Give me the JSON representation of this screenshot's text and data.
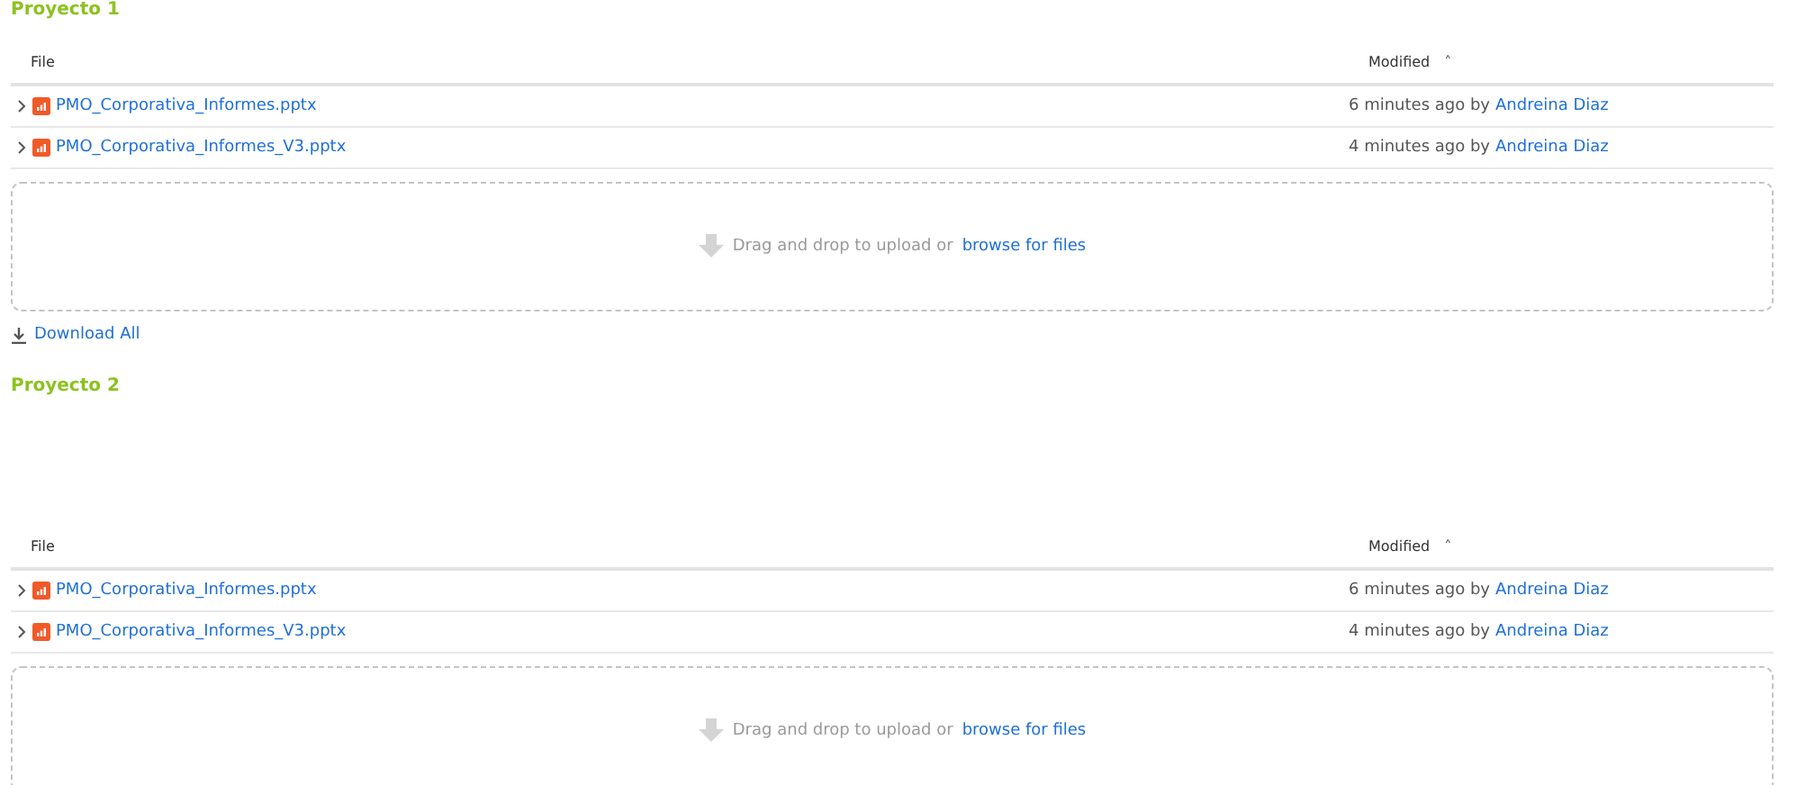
{
  "sections": [
    {
      "title": "Proyecto 1",
      "columns": [
        {
          "label": "File"
        },
        {
          "label": "Modified",
          "sort_indicator": "˄"
        }
      ],
      "rows": [
        {
          "name": "PMO_Corporativa_Informes.pptx",
          "modified": "6 minutes ago by",
          "author": "Andreina Diaz"
        },
        {
          "name": "PMO_Corporativa_Informes_V3.pptx",
          "modified": "4 minutes ago by",
          "author": "Andreina Diaz"
        }
      ],
      "dropzone": {
        "text": "Drag and drop to upload or",
        "link": "browse for files"
      },
      "download_all": "Download All"
    },
    {
      "title": "Proyecto 2",
      "columns": [
        {
          "label": "File"
        },
        {
          "label": "Modified",
          "sort_indicator": "˄"
        }
      ],
      "rows": [
        {
          "name": "PMO_Corporativa_Informes.pptx",
          "modified": "6 minutes ago by",
          "author": "Andreina Diaz"
        },
        {
          "name": "PMO_Corporativa_Informes_V3.pptx",
          "modified": "4 minutes ago by",
          "author": "Andreina Diaz"
        }
      ],
      "dropzone": {
        "text": "Drag and drop to upload or",
        "link": "browse for files"
      }
    }
  ]
}
